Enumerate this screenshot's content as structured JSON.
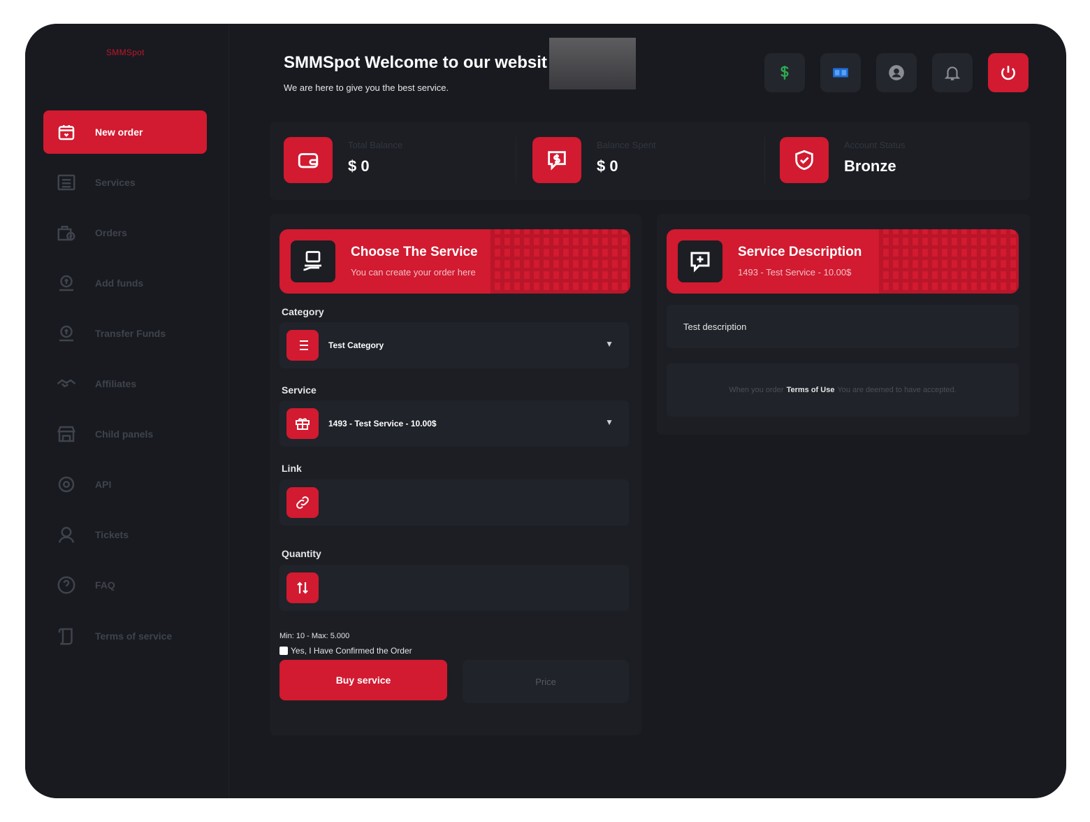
{
  "brand": {
    "logo_text": "SMMSpot",
    "accent": "#d21a30",
    "background": "#181a20"
  },
  "header": {
    "title": "SMMSpot Welcome to our websit",
    "subtitle": "We are here to give you the best service.",
    "buttons": [
      {
        "name": "dollar-icon",
        "color": "#2ea84f"
      },
      {
        "name": "language-icon",
        "color": "#1f6fd6"
      },
      {
        "name": "user-icon",
        "color": "#8a8d94"
      },
      {
        "name": "bell-icon",
        "color": "#8a8d94"
      },
      {
        "name": "power-icon",
        "color": "#ffffff"
      }
    ]
  },
  "sidebar": {
    "items": [
      {
        "label": "New order",
        "icon": "cart-icon",
        "active": true
      },
      {
        "label": "Services",
        "icon": "list-icon"
      },
      {
        "label": "Orders",
        "icon": "orders-icon"
      },
      {
        "label": "Add funds",
        "icon": "money-bag-icon"
      },
      {
        "label": "Transfer Funds",
        "icon": "money-bag-icon"
      },
      {
        "label": "Affiliates",
        "icon": "handshake-icon"
      },
      {
        "label": "Child panels",
        "icon": "store-icon"
      },
      {
        "label": "API",
        "icon": "gear-icon"
      },
      {
        "label": "Tickets",
        "icon": "support-icon"
      },
      {
        "label": "FAQ",
        "icon": "question-icon"
      },
      {
        "label": "Terms of service",
        "icon": "scroll-icon"
      }
    ]
  },
  "stats": [
    {
      "label": "Total Balance",
      "value": "$ 0",
      "icon": "wallet-icon"
    },
    {
      "label": "Balance Spent",
      "value": "$ 0",
      "icon": "money-chat-icon"
    },
    {
      "label": "Account Status",
      "value": "Bronze",
      "icon": "shield-check-icon"
    }
  ],
  "order": {
    "banner_title": "Choose The Service",
    "banner_subtitle": "You can create your order here",
    "category_label": "Category",
    "category_value": "Test Category",
    "service_label": "Service",
    "service_value": "1493 - Test Service - 10.00$",
    "link_label": "Link",
    "link_value": "",
    "quantity_label": "Quantity",
    "quantity_value": "",
    "min_max": "Min: 10 - Max: 5.000",
    "confirm_label": "Yes, I Have Confirmed the Order",
    "buy_label": "Buy service",
    "price_placeholder": "Price"
  },
  "description": {
    "banner_title": "Service Description",
    "banner_subtitle": "1493 - Test Service - 10.00$",
    "text": "Test description",
    "terms_prefix": "When you order",
    "terms_link": "Terms of Use",
    "terms_suffix": "You are deemed to have accepted."
  }
}
